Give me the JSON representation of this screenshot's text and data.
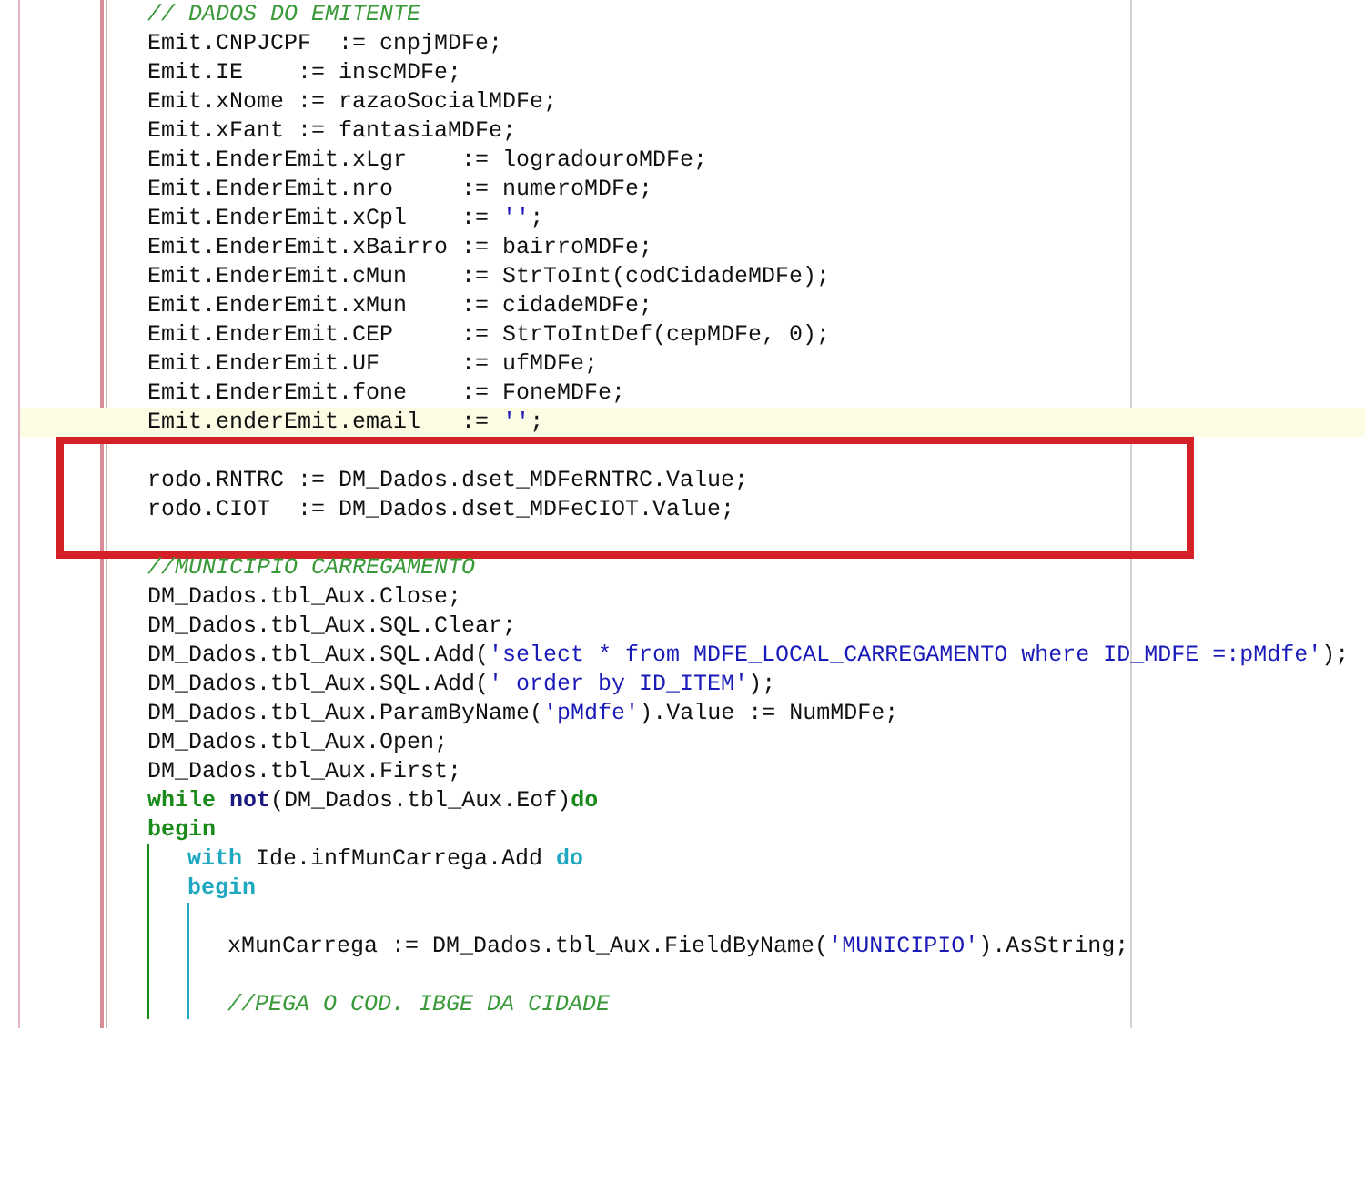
{
  "annotation": {
    "kind": "rectangle"
  },
  "lines": [
    {
      "current": false,
      "tokens": [
        {
          "kind": "comment",
          "text": "// DADOS DO EMITENTE"
        }
      ]
    },
    {
      "current": false,
      "tokens": [
        {
          "kind": "code",
          "text": "Emit.CNPJCPF  := cnpjMDFe;"
        }
      ]
    },
    {
      "current": false,
      "tokens": [
        {
          "kind": "code",
          "text": "Emit.IE    := inscMDFe;"
        }
      ]
    },
    {
      "current": false,
      "tokens": [
        {
          "kind": "code",
          "text": "Emit.xNome := razaoSocialMDFe;"
        }
      ]
    },
    {
      "current": false,
      "tokens": [
        {
          "kind": "code",
          "text": "Emit.xFant := fantasiaMDFe;"
        }
      ]
    },
    {
      "current": false,
      "tokens": [
        {
          "kind": "code",
          "text": "Emit.EnderEmit.xLgr    := logradouroMDFe;"
        }
      ]
    },
    {
      "current": false,
      "tokens": [
        {
          "kind": "code",
          "text": "Emit.EnderEmit.nro     := numeroMDFe;"
        }
      ]
    },
    {
      "current": false,
      "tokens": [
        {
          "kind": "code",
          "text": "Emit.EnderEmit.xCpl    := "
        },
        {
          "kind": "string",
          "text": "''"
        },
        {
          "kind": "code",
          "text": ";"
        }
      ]
    },
    {
      "current": false,
      "tokens": [
        {
          "kind": "code",
          "text": "Emit.EnderEmit.xBairro := bairroMDFe;"
        }
      ]
    },
    {
      "current": false,
      "tokens": [
        {
          "kind": "code",
          "text": "Emit.EnderEmit.cMun    := StrToInt(codCidadeMDFe);"
        }
      ]
    },
    {
      "current": false,
      "tokens": [
        {
          "kind": "code",
          "text": "Emit.EnderEmit.xMun    := cidadeMDFe;"
        }
      ]
    },
    {
      "current": false,
      "tokens": [
        {
          "kind": "code",
          "text": "Emit.EnderEmit.CEP     := StrToIntDef(cepMDFe, 0);"
        }
      ]
    },
    {
      "current": false,
      "tokens": [
        {
          "kind": "code",
          "text": "Emit.EnderEmit.UF      := ufMDFe;"
        }
      ]
    },
    {
      "current": false,
      "tokens": [
        {
          "kind": "code",
          "text": "Emit.EnderEmit.fone    := FoneMDFe;"
        }
      ]
    },
    {
      "current": true,
      "tokens": [
        {
          "kind": "code",
          "text": "Emit.enderEmit.email   := "
        },
        {
          "kind": "string",
          "text": "''"
        },
        {
          "kind": "code",
          "text": ";"
        }
      ]
    },
    {
      "current": false
    },
    {
      "current": false,
      "tokens": [
        {
          "kind": "code",
          "text": "rodo.RNTRC := DM_Dados.dset_MDFeRNTRC.Value;"
        }
      ]
    },
    {
      "current": false,
      "tokens": [
        {
          "kind": "code",
          "text": "rodo.CIOT  := DM_Dados.dset_MDFeCIOT.Value;"
        }
      ]
    },
    {
      "current": false
    },
    {
      "current": false,
      "tokens": [
        {
          "kind": "comment",
          "text": "//MUNICIPIO CARREGAMENTO"
        }
      ]
    },
    {
      "current": false,
      "tokens": [
        {
          "kind": "code",
          "text": "DM_Dados.tbl_Aux.Close;"
        }
      ]
    },
    {
      "current": false,
      "tokens": [
        {
          "kind": "code",
          "text": "DM_Dados.tbl_Aux.SQL.Clear;"
        }
      ]
    },
    {
      "current": false,
      "tokens": [
        {
          "kind": "code",
          "text": "DM_Dados.tbl_Aux.SQL.Add("
        },
        {
          "kind": "string",
          "text": "'select * from MDFE_LOCAL_CARREGAMENTO where ID_MDFE =:pMdfe'"
        },
        {
          "kind": "code",
          "text": ");"
        }
      ]
    },
    {
      "current": false,
      "tokens": [
        {
          "kind": "code",
          "text": "DM_Dados.tbl_Aux.SQL.Add("
        },
        {
          "kind": "string",
          "text": "' order by ID_ITEM'"
        },
        {
          "kind": "code",
          "text": ");"
        }
      ]
    },
    {
      "current": false,
      "tokens": [
        {
          "kind": "code",
          "text": "DM_Dados.tbl_Aux.ParamByName("
        },
        {
          "kind": "string",
          "text": "'pMdfe'"
        },
        {
          "kind": "code",
          "text": ").Value := NumMDFe;"
        }
      ]
    },
    {
      "current": false,
      "tokens": [
        {
          "kind": "code",
          "text": "DM_Dados.tbl_Aux.Open;"
        }
      ]
    },
    {
      "current": false,
      "tokens": [
        {
          "kind": "code",
          "text": "DM_Dados.tbl_Aux.First;"
        }
      ]
    },
    {
      "current": false,
      "tokens": [
        {
          "kind": "keyword",
          "text": "while",
          "color": "#1a8a1a"
        },
        {
          "kind": "keyword",
          "text": "not",
          "color": "#1a1a80"
        },
        {
          "kind": "code",
          "text": "(DM_Dados.tbl_Aux.Eof)"
        },
        {
          "kind": "keyword",
          "text": "do",
          "color": "#1a8a1a"
        }
      ]
    },
    {
      "current": false,
      "tokens": [
        {
          "kind": "keyword",
          "text": "begin",
          "color": "#1a8a1a"
        }
      ],
      "children": [
        {
          "current": false,
          "tokens": [
            {
              "kind": "keyword",
              "text": "with",
              "color": "#20a8c0"
            },
            {
              "kind": "code",
              "text": " Ide.infMunCarrega.Add "
            },
            {
              "kind": "keyword",
              "text": "do",
              "color": "#20a8c0"
            }
          ]
        },
        {
          "current": false,
          "tokens": [
            {
              "kind": "keyword",
              "text": "begin",
              "color": "#20a8c0"
            }
          ],
          "children": [
            {
              "current": false
            },
            {
              "current": false,
              "tokens": [
                {
                  "kind": "code",
                  "text": "xMunCarrega := DM_Dados.tbl_Aux.FieldByName("
                },
                {
                  "kind": "string",
                  "text": "'MUNICIPIO'"
                },
                {
                  "kind": "code",
                  "text": ").AsString;"
                }
              ]
            },
            {
              "current": false
            },
            {
              "current": false,
              "tokens": [
                {
                  "kind": "comment",
                  "text": "//PEGA O COD. IBGE DA CIDADE"
                }
              ]
            }
          ]
        }
      ]
    }
  ]
}
